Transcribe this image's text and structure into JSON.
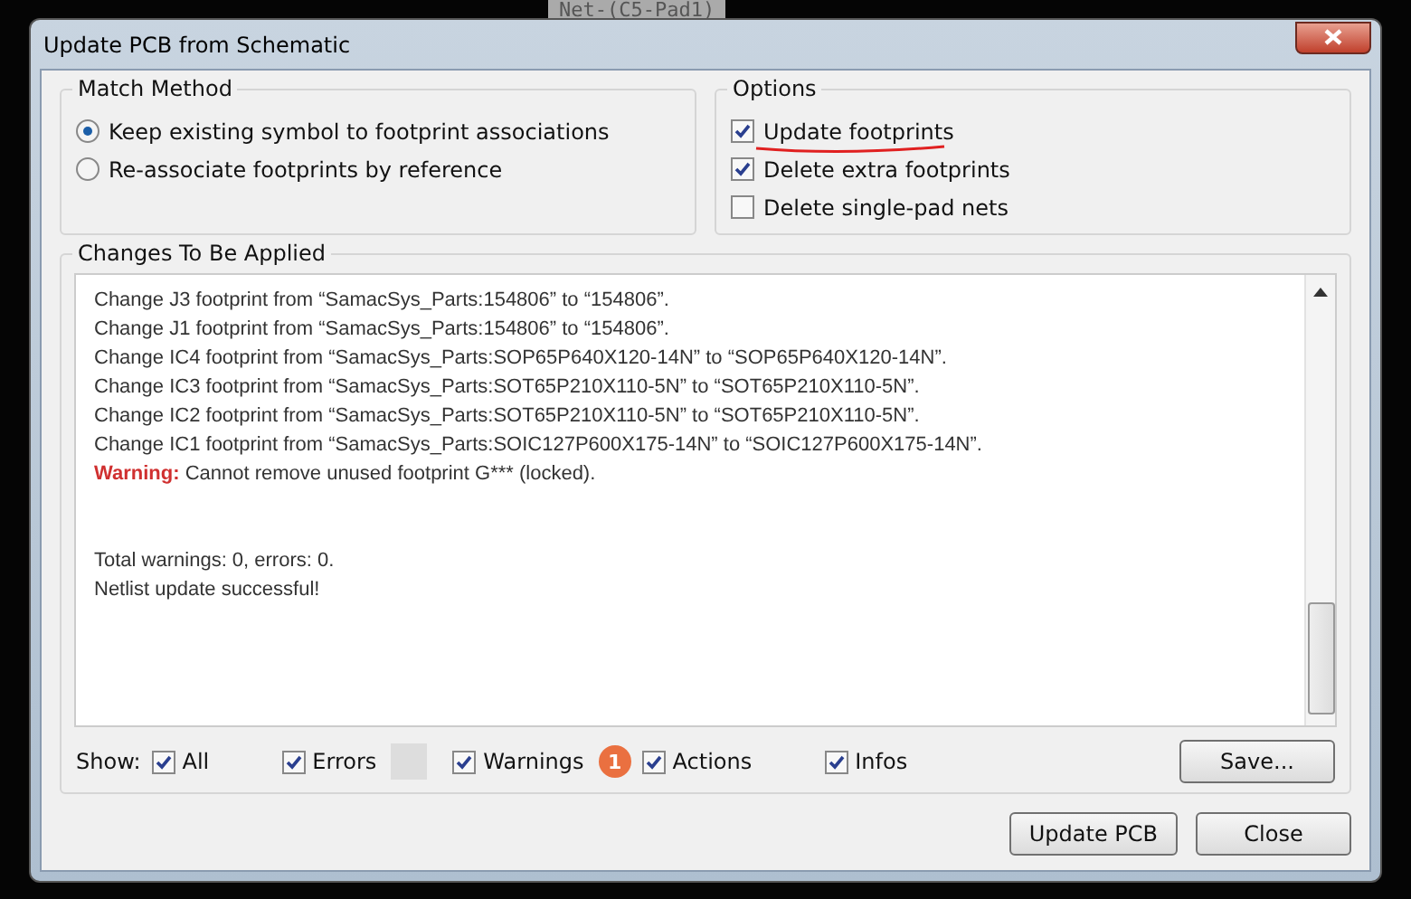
{
  "background_label": "Net-(C5-Pad1)",
  "window": {
    "title": "Update PCB from Schematic"
  },
  "match_method": {
    "title": "Match Method",
    "options": [
      {
        "label": "Keep existing symbol to footprint associations",
        "selected": true
      },
      {
        "label": "Re-associate footprints by reference",
        "selected": false
      }
    ]
  },
  "options": {
    "title": "Options",
    "items": [
      {
        "label": "Update footprints",
        "checked": true,
        "underlined": true
      },
      {
        "label": "Delete extra footprints",
        "checked": true,
        "underlined": false
      },
      {
        "label": "Delete single-pad nets",
        "checked": false,
        "underlined": false
      }
    ]
  },
  "changes": {
    "title": "Changes To Be Applied",
    "lines": [
      {
        "kind": "info",
        "text": "Change J3 footprint from “SamacSys_Parts:154806” to “154806”."
      },
      {
        "kind": "info",
        "text": "Change J1 footprint from “SamacSys_Parts:154806” to “154806”."
      },
      {
        "kind": "info",
        "text": "Change IC4 footprint from “SamacSys_Parts:SOP65P640X120-14N” to “SOP65P640X120-14N”."
      },
      {
        "kind": "info",
        "text": "Change IC3 footprint from “SamacSys_Parts:SOT65P210X110-5N” to “SOT65P210X110-5N”."
      },
      {
        "kind": "info",
        "text": "Change IC2 footprint from “SamacSys_Parts:SOT65P210X110-5N” to “SOT65P210X110-5N”."
      },
      {
        "kind": "info",
        "text": "Change IC1 footprint from “SamacSys_Parts:SOIC127P600X175-14N” to “SOIC127P600X175-14N”."
      },
      {
        "kind": "warning",
        "prefix": "Warning:",
        "text": "Cannot remove unused footprint G*** (locked)."
      },
      {
        "kind": "blank"
      },
      {
        "kind": "blank"
      },
      {
        "kind": "info",
        "text": "Total warnings: 0, errors: 0."
      },
      {
        "kind": "info",
        "text": "Netlist update successful!"
      }
    ]
  },
  "show": {
    "label": "Show:",
    "filters": [
      {
        "label": "All",
        "checked": true,
        "swatch": false
      },
      {
        "label": "Errors",
        "checked": true,
        "swatch": true
      },
      {
        "label": "Warnings",
        "checked": true,
        "swatch": false,
        "badge": "1"
      },
      {
        "label": "Actions",
        "checked": true,
        "swatch": false
      },
      {
        "label": "Infos",
        "checked": true,
        "swatch": false
      }
    ]
  },
  "save_button": "Save...",
  "buttons": [
    "Update PCB",
    "Close"
  ]
}
